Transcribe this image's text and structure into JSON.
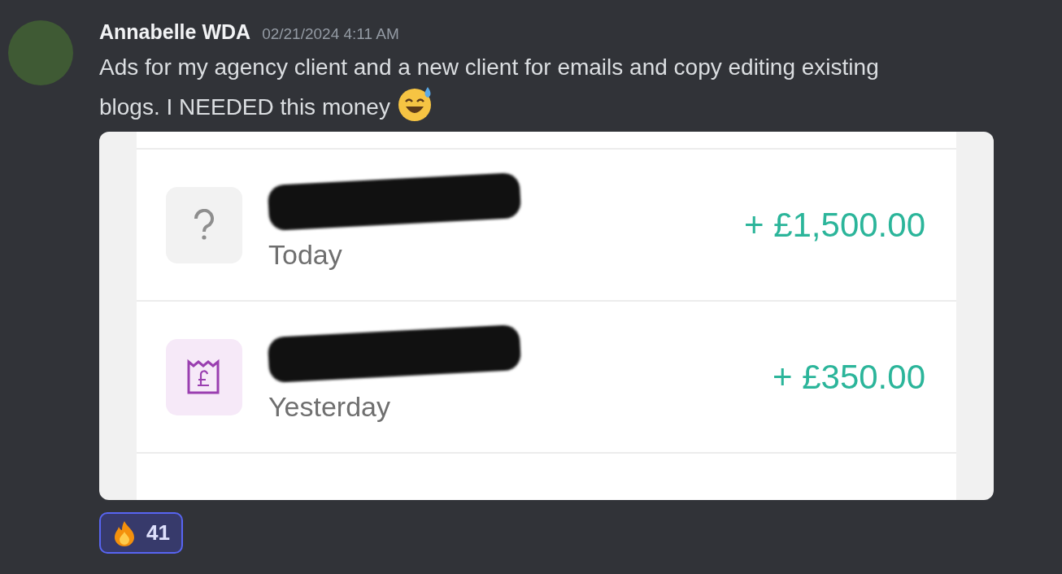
{
  "message": {
    "author": "Annabelle WDA",
    "timestamp": "02/21/2024 4:11 AM",
    "text": "Ads for my agency client and a new client for emails and copy editing existing blogs. I NEEDED this money",
    "attachment": {
      "transactions": [
        {
          "kind": "unknown",
          "redacted": true,
          "date": "Today",
          "amount": "+ £1,500.00"
        },
        {
          "kind": "receipt",
          "redacted": true,
          "date": "Yesterday",
          "amount": "+ £350.00"
        }
      ]
    },
    "reactions": [
      {
        "count": "41",
        "selected": true
      }
    ]
  }
}
